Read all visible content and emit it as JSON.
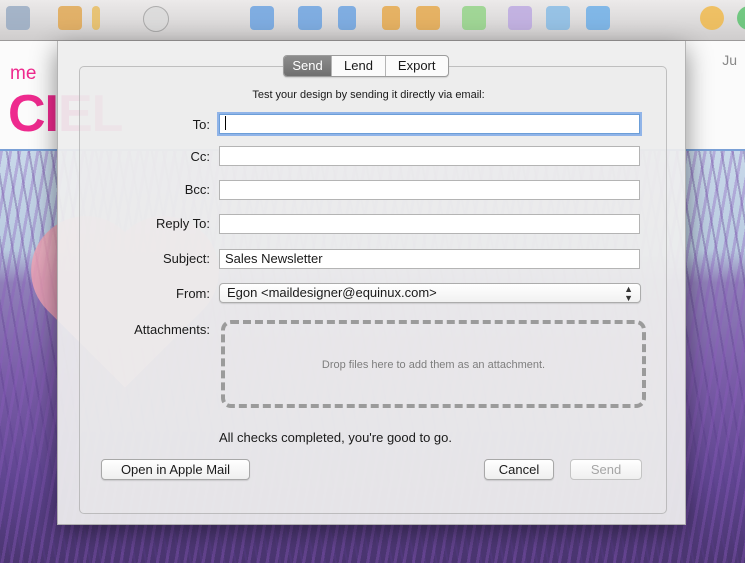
{
  "background": {
    "right_label": "Ju",
    "brand_small": "me",
    "brand_big": "CIEL",
    "toolbar_icons": [
      "mail-icon",
      "move-icon",
      "ruler-icon",
      "clock-icon",
      "shape-icon",
      "shape-icon",
      "align-icon",
      "rotate-icon",
      "arrow-icon",
      "image-icon",
      "text-icon",
      "brush-icon",
      "tools-icon",
      "sun-icon",
      "color-icon"
    ]
  },
  "dialog": {
    "tabs": [
      {
        "label": "Send",
        "active": true
      },
      {
        "label": "Lend",
        "active": false
      },
      {
        "label": "Export",
        "active": false
      }
    ],
    "hint": "Test your design by sending it directly via email:",
    "fields": {
      "to": {
        "label": "To:",
        "value": ""
      },
      "cc": {
        "label": "Cc:",
        "value": ""
      },
      "bcc": {
        "label": "Bcc:",
        "value": ""
      },
      "reply_to": {
        "label": "Reply To:",
        "value": ""
      },
      "subject": {
        "label": "Subject:",
        "value": "Sales Newsletter"
      },
      "from": {
        "label": "From:",
        "value": "Egon <maildesigner@equinux.com>"
      }
    },
    "attachments": {
      "label": "Attachments:",
      "placeholder": "Drop files here to add them as an attachment."
    },
    "status": "All checks completed, you're good to go.",
    "buttons": {
      "open_in_mail": "Open in Apple Mail",
      "cancel": "Cancel",
      "send": "Send"
    }
  }
}
